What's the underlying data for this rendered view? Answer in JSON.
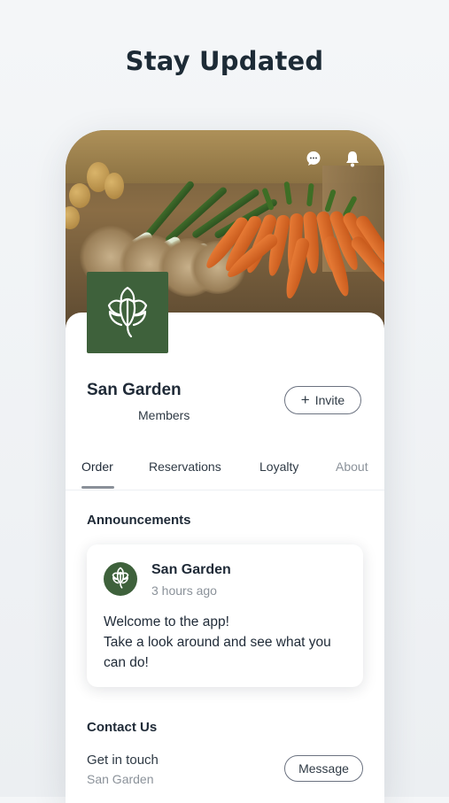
{
  "headline": "Stay Updated",
  "colors": {
    "brand_green": "#3e613b",
    "text_dark": "#1f2a37",
    "text_muted": "#8b929a"
  },
  "icons": {
    "chat": "chat-bubble-icon",
    "bell": "notification-bell-icon",
    "logo": "artichoke-logo-icon",
    "plus": "plus-icon"
  },
  "business": {
    "name": "San Garden",
    "members_label": "Members",
    "invite_label": "Invite"
  },
  "tabs": [
    {
      "label": "Order",
      "active": true
    },
    {
      "label": "Reservations",
      "active": false
    },
    {
      "label": "Loyalty",
      "active": false
    },
    {
      "label": "About",
      "active": false
    }
  ],
  "announcements": {
    "title": "Announcements",
    "post": {
      "author": "San Garden",
      "time": "3 hours ago",
      "body_lines": [
        "Welcome to the app!",
        "Take a look around and see what you",
        "can do!"
      ]
    }
  },
  "contact": {
    "title": "Contact Us",
    "line": "Get in touch",
    "sub": "San Garden",
    "message_label": "Message"
  }
}
